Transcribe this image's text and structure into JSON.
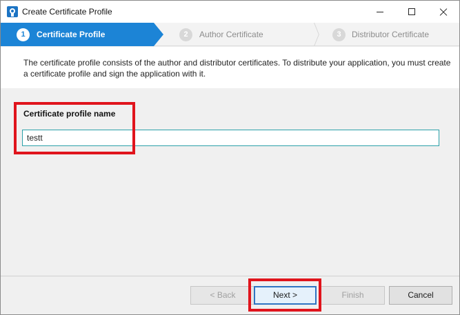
{
  "window": {
    "title": "Create Certificate Profile",
    "icon": "certificate-app-icon"
  },
  "steps": [
    {
      "number": "1",
      "label": "Certificate Profile",
      "active": true
    },
    {
      "number": "2",
      "label": "Author Certificate",
      "active": false
    },
    {
      "number": "3",
      "label": "Distributor Certificate",
      "active": false
    }
  ],
  "description": "The certificate profile consists of the author and distributor certificates. To distribute your application, you must create a certificate profile and sign the application with it.",
  "form": {
    "profile_name_label": "Certificate profile name",
    "profile_name_value": "testt"
  },
  "buttons": {
    "back": "< Back",
    "next": "Next >",
    "finish": "Finish",
    "cancel": "Cancel"
  },
  "colors": {
    "accent": "#1c84d6",
    "highlight": "#e0141c",
    "input_border": "#2aa0a8"
  }
}
